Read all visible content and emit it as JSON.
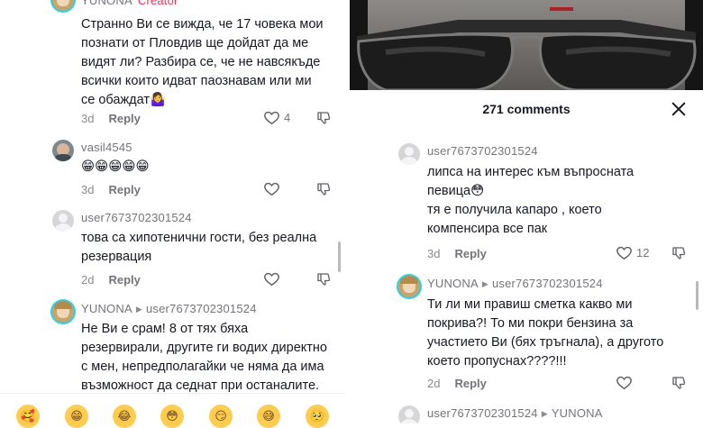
{
  "left": {
    "top_comment": {
      "username": "YUNONA",
      "tag": "Creator",
      "text_lines": [
        "Странно Ви се вижда, че 17 човека мои",
        "познати от Пловдив ще дойдат да ме",
        "видят ли? Разбира се, че не навсякъде",
        "всички които идват паознавам или ми",
        "се обаждат🤷‍♀️"
      ],
      "age": "3d",
      "reply_label": "Reply",
      "likes": "4"
    },
    "comments": [
      {
        "username": "vasil4545",
        "text_lines": [
          "😁😁😁😁😁"
        ],
        "age": "3d",
        "reply_label": "Reply",
        "likes": ""
      },
      {
        "username": "user7673702301524",
        "text_lines": [
          "това са хипотенични гости, без реална",
          "резервация"
        ],
        "age": "2d",
        "reply_label": "Reply",
        "likes": ""
      },
      {
        "username": "YUNONA",
        "reply_to": "user7673702301524",
        "text_lines": [
          "Не Ви е срам! 8 от тях бяха",
          "резервирали, другите ги водих директно",
          "с мен, непредполагайки че няма да има",
          "възможност да седнат при останалите."
        ]
      }
    ],
    "emoji_bar": [
      "🥰",
      "😁",
      "😂",
      "😳",
      "😏",
      "😅",
      "🥺"
    ]
  },
  "right": {
    "sheet_title": "271 comments",
    "comments": [
      {
        "username": "user7673702301524",
        "text_lines": [
          "липса на интерес към въпросната",
          "певица😳",
          "тя е получила капаро , което",
          "компенсира все пак"
        ],
        "age": "3d",
        "reply_label": "Reply",
        "likes": "12"
      },
      {
        "username": "YUNONA",
        "reply_to": "user7673702301524",
        "text_lines": [
          "Ти ли ми правиш сметка какво ми",
          "покрива?! То ми покри бензина за",
          "участието Ви (бях тръгнала), а другото",
          "което пропуснах????!!!"
        ],
        "age": "2d",
        "reply_label": "Reply",
        "likes": ""
      },
      {
        "username": "user7673702301524",
        "reply_to": "YUNONA"
      }
    ]
  }
}
